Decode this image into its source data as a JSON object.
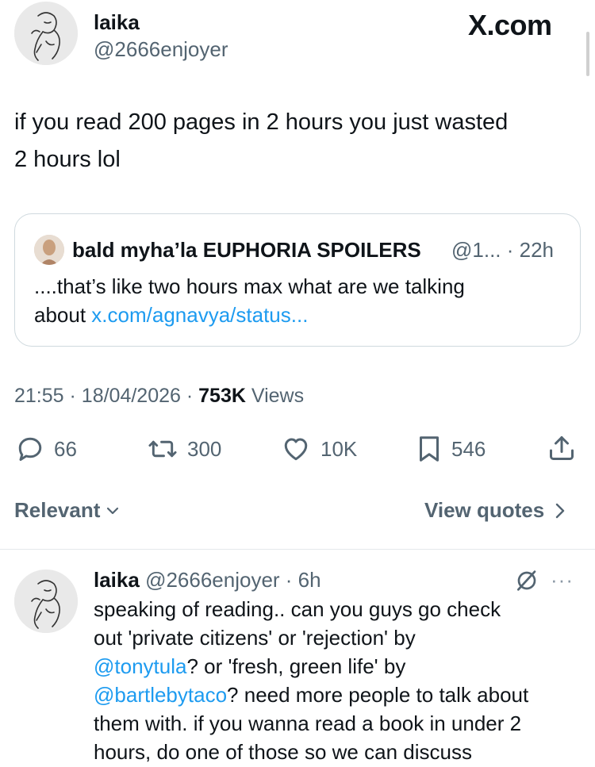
{
  "tweet": {
    "author_name": "laika",
    "author_handle": "@2666enjoyer",
    "brand": "X.com",
    "text_line1": "if you read 200 pages in 2 hours you just wasted",
    "text_line2": "2 hours lol",
    "quote": {
      "name": "bald myha’la EUPHORIA SPOILERS",
      "meta": "@1... · 22h",
      "text_line1": "....that’s like two hours max what are we talking",
      "text_prefix": "about ",
      "link": "x.com/agnavya/status..."
    },
    "time": "21:55",
    "date": "18/04/2026",
    "views_count": "753K",
    "views_label": "Views",
    "sep": "·",
    "actions": {
      "replies": "66",
      "reposts": "300",
      "likes": "10K",
      "bookmarks": "546"
    }
  },
  "filters": {
    "relevant_label": "Relevant",
    "view_quotes_label": "View quotes"
  },
  "reply": {
    "name": "laika",
    "handle_time": "@2666enjoyer · 6h",
    "more": "···",
    "line1": "speaking of reading.. can you guys go check",
    "line2": "out 'private citizens' or 'rejection' by",
    "mention1": "@tonytula",
    "line3_rest": "? or 'fresh, green life' by",
    "mention2": "@bartlebytaco",
    "line4_rest": "? need more people to talk about",
    "line5": "them with. if you wanna read a book in under 2",
    "line6": "hours, do one of those so we can discuss"
  },
  "icons": {
    "reply": "speech-bubble-icon",
    "repost": "repost-arrows-icon",
    "like": "heart-icon",
    "bookmark": "bookmark-icon",
    "share": "share-upload-icon",
    "grok": "grok-slash-circle-icon"
  },
  "colors": {
    "text": "#0f1419",
    "secondary": "#536471",
    "link": "#1d9bf0",
    "border": "#cfd9de"
  }
}
